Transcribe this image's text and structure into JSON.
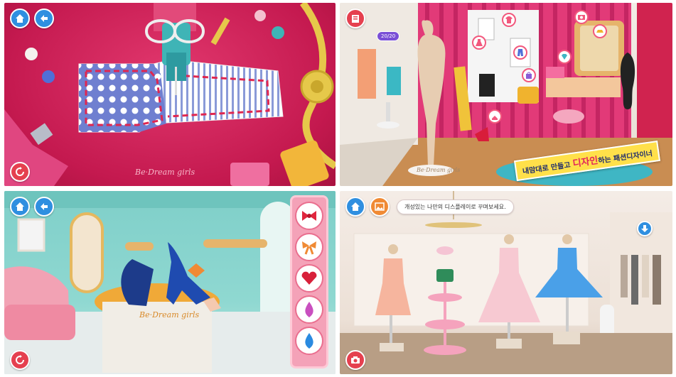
{
  "panel1": {
    "logo_text": "Be·Dream girls",
    "buttons": [
      "home",
      "back",
      "reset"
    ]
  },
  "panel2": {
    "counter": "20/20",
    "banner_pre": "내맘대로 만들고 ",
    "banner_highlight": "디자인",
    "banner_post": "하는 패션디자이너",
    "logo_text": "Be·Dream girls"
  },
  "panel3": {
    "logo_text": "Be·Dream girls",
    "side_items": [
      "bow-red",
      "bow-orange",
      "heart-gem",
      "drop-gem-pink",
      "drop-gem-blue"
    ]
  },
  "panel4": {
    "hint": "개성있는 나만의 디스플레이로 꾸며보세요."
  },
  "colors": {
    "accent_pink": "#e2386e",
    "button_blue": "#2f8fe0",
    "button_red": "#e5404f",
    "banner_yellow": "#ffe04a"
  }
}
